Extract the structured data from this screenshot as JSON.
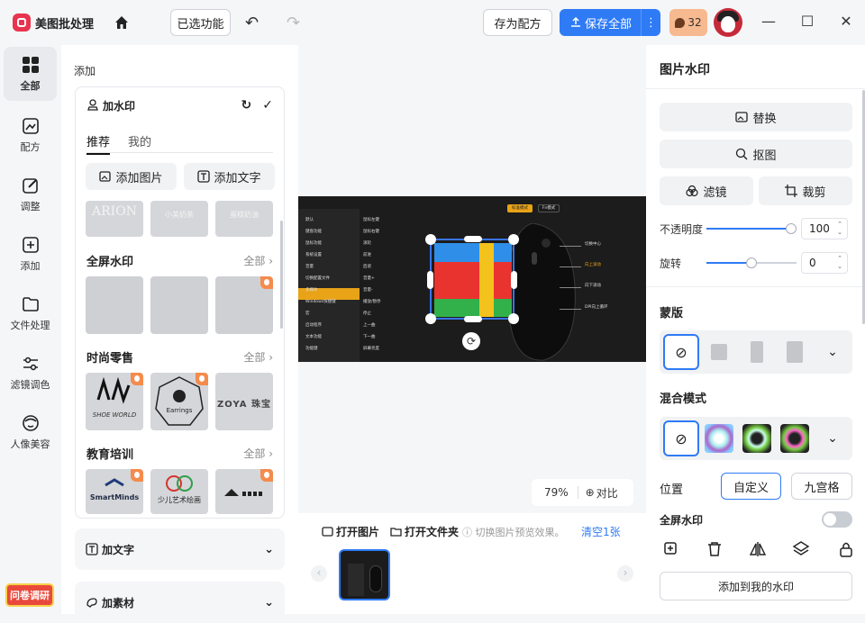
{
  "app": {
    "title": "美图批处理"
  },
  "topbar": {
    "selected_features": "已选功能",
    "save_recipe": "存为配方",
    "save_all": "保存全部",
    "coins": "32"
  },
  "nav": {
    "items": [
      {
        "label": "全部",
        "icon": "grid-icon"
      },
      {
        "label": "配方",
        "icon": "recipe-icon"
      },
      {
        "label": "调整",
        "icon": "edit-icon"
      },
      {
        "label": "添加",
        "icon": "plus-square-icon"
      },
      {
        "label": "文件处理",
        "icon": "folder-icon"
      },
      {
        "label": "滤镜调色",
        "icon": "sliders-icon"
      },
      {
        "label": "人像美容",
        "icon": "face-icon"
      }
    ],
    "survey": "问卷调研"
  },
  "panel": {
    "title": "添加",
    "watermark": {
      "title": "加水印",
      "tabs": [
        "推荐",
        "我的"
      ],
      "add_image": "添加图片",
      "add_text": "添加文字",
      "top_partial": [
        "ARION",
        "小美奶茶",
        "蛋糕奶油"
      ],
      "sections": [
        {
          "title": "全屏水印",
          "more": "全部"
        },
        {
          "title": "时尚零售",
          "more": "全部",
          "thumbs": [
            "SHOE WORLD",
            "Earrings",
            "ZOYA 珠宝"
          ]
        },
        {
          "title": "教育培训",
          "more": "全部",
          "thumbs": [
            "SmartMinds",
            "少儿艺术绘画",
            ""
          ]
        }
      ]
    },
    "add_text": "加文字",
    "add_material": "加素材"
  },
  "canvas": {
    "zoom": "79%",
    "compare": "对比",
    "tags": [
      "标准模式",
      "Fn模式"
    ],
    "menu_left": [
      "默认",
      "键盘功能",
      "鼠标功能",
      "系统设置",
      "音量",
      "切换配置文件",
      "多媒体",
      "Windows快捷键",
      "宏",
      "启动程序",
      "文本功能",
      "功能键"
    ],
    "menu_mid": [
      "鼠标左键",
      "鼠标右键",
      "滚轮",
      "前进",
      "后退",
      "音量+",
      "音量-",
      "播放/暂停",
      "停止",
      "上一曲",
      "下一曲",
      "屏幕亮度"
    ],
    "callouts": [
      "切换中心",
      "向上滚动",
      "向下滚动",
      "DPI向上循环"
    ]
  },
  "bottom": {
    "open_image": "打开图片",
    "open_folder": "打开文件夹",
    "hint": "切换图片预览效果。",
    "clear": "清空1张"
  },
  "right": {
    "title": "图片水印",
    "replace": "替换",
    "cutout": "抠图",
    "filter": "滤镜",
    "crop": "裁剪",
    "opacity_label": "不透明度",
    "opacity_value": "100",
    "opacity": 1.0,
    "rotate_label": "旋转",
    "rotate_value": "0",
    "rotate": 0.5,
    "mask_label": "蒙版",
    "blend_label": "混合模式",
    "position_label": "位置",
    "custom": "自定义",
    "grid9": "九宫格",
    "fullscreen_label": "全屏水印",
    "add_to_mine": "添加到我的水印"
  },
  "colors": {
    "accent": "#2f7bf5",
    "vip": "#f58b4c",
    "brand": "#e8344e"
  }
}
